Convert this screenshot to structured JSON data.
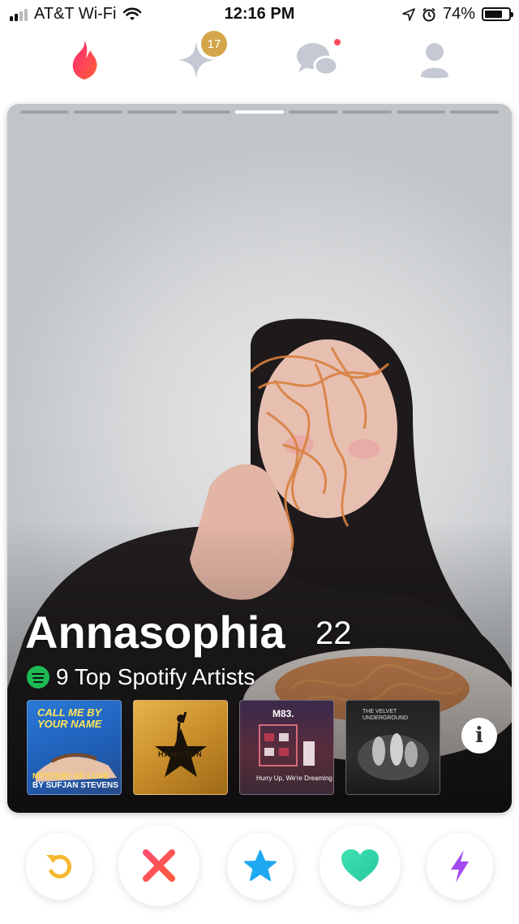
{
  "status_bar": {
    "carrier": "AT&T Wi-Fi",
    "time": "12:16 PM",
    "battery": "74%",
    "battery_level": 0.74
  },
  "top_nav": {
    "items": [
      {
        "name": "flame",
        "icon": "flame-icon",
        "color": "#fd5068"
      },
      {
        "name": "gold",
        "icon": "sparkle-icon",
        "badge": "17",
        "badge_color": "#d4a64a"
      },
      {
        "name": "chats",
        "icon": "chat-bubbles-icon",
        "has_notification_dot": true
      },
      {
        "name": "profile",
        "icon": "person-icon"
      }
    ]
  },
  "card": {
    "name": "Annasophia",
    "age": "22",
    "photo_count": 9,
    "active_photo": 4,
    "spotify": {
      "label": "9 Top Spotify Artists",
      "color": "#1db954",
      "albums": [
        {
          "title": "CALL ME BY YOUR NAME",
          "song": "MYSTERY OF LOVE",
          "artist": "BY SUFJAN STEVENS"
        },
        {
          "title": "HAMILTON"
        },
        {
          "title": "M83.",
          "subtitle": "Hurry Up, We're Dreaming"
        },
        {
          "title": "THE VELVET UNDERGROUND"
        }
      ]
    },
    "info_icon": "i"
  },
  "actions": [
    {
      "name": "rewind",
      "icon": "rewind-icon",
      "color": "#f5b82e"
    },
    {
      "name": "nope",
      "icon": "close-icon",
      "color": "#fd4a5c"
    },
    {
      "name": "super-like",
      "icon": "star-icon",
      "color": "#1ea8f0"
    },
    {
      "name": "like",
      "icon": "heart-icon",
      "color": "#33d6a6"
    },
    {
      "name": "boost",
      "icon": "lightning-icon",
      "color": "#a34af0"
    }
  ]
}
